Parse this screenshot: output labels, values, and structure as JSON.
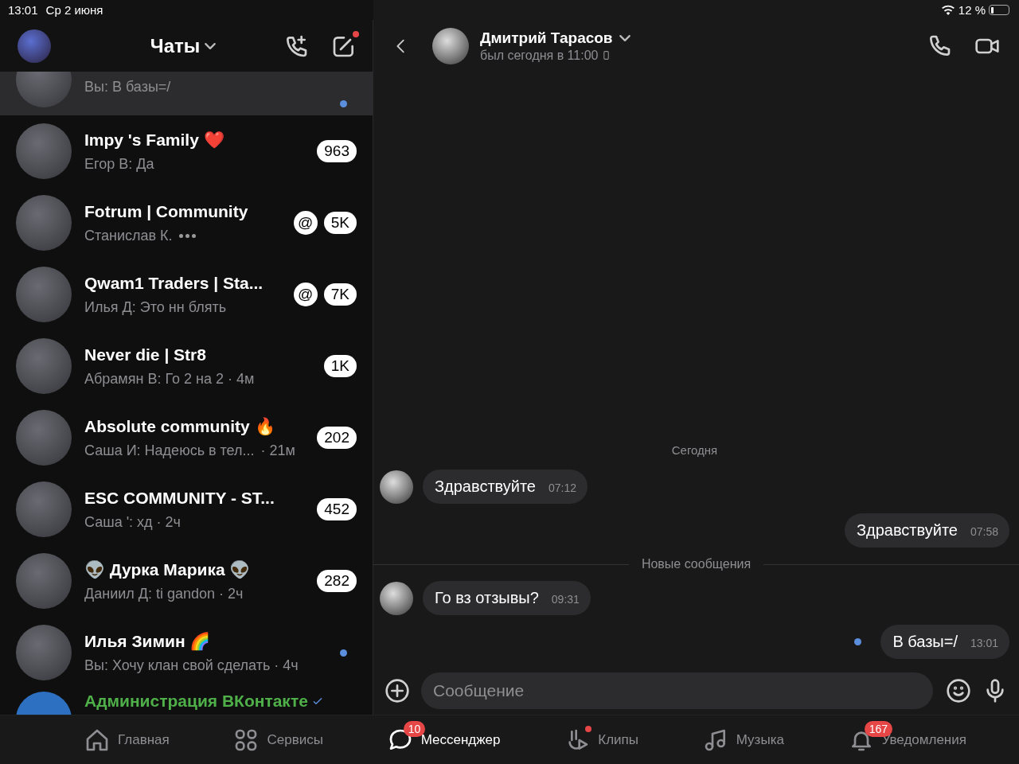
{
  "status_bar": {
    "time": "13:01",
    "date": "Ср 2 июня",
    "battery": "12 %"
  },
  "chats_header": {
    "title": "Чаты",
    "compose_dot": true
  },
  "chats": [
    {
      "preview": "Вы: В базы=/",
      "unread_dot": true,
      "selected": true
    },
    {
      "name": "Impy 's Family ❤️",
      "preview": "Егор В: Да",
      "count": "963",
      "unread_dot": false,
      "selected": false
    },
    {
      "name": "Fotrum | Community",
      "preview": "Станислав К.",
      "typing": true,
      "count": "5K",
      "mention": "@",
      "unread_dot": false,
      "selected": false
    },
    {
      "name": "Qwam1 Traders | Sta...",
      "preview": "Илья Д: Это нн блять",
      "count": "7K",
      "mention": "@",
      "unread_dot": false,
      "selected": false
    },
    {
      "name": "Never die | Str8",
      "preview": "Абрамян В: Го 2 на 2 · 4м",
      "count": "1K",
      "unread_dot": false,
      "selected": false
    },
    {
      "name": "Absolute community 🔥",
      "preview": "Саша И: Надеюсь в тел...",
      "time": "· 21м",
      "count": "202",
      "unread_dot": false,
      "selected": false
    },
    {
      "name": "ESC COMMUNITY - ST...",
      "preview": "Саша ': хд · 2ч",
      "count": "452",
      "unread_dot": false,
      "selected": false
    },
    {
      "name": "👽 Дурка Марика 👽",
      "preview": "Даниил Д: ti gandon · 2ч",
      "count": "282",
      "unread_dot": false,
      "selected": false
    },
    {
      "name": "Илья Зимин 🌈",
      "preview": "Вы: Хочу клан свой сделать · 4ч",
      "unread_dot": true,
      "selected": false
    },
    {
      "name": "Администрация ВКонтакте",
      "verified": true,
      "selected": false
    }
  ],
  "conversation": {
    "name": "Дмитрий Тарасов",
    "last_seen": "был сегодня в 11:00",
    "messages": [
      {
        "kind": "date",
        "text": "Сегодня"
      },
      {
        "kind": "incoming",
        "text": "Здравствуйте",
        "time": "07:12"
      },
      {
        "kind": "outgoing",
        "text": "Здравствуйте",
        "time": "07:58",
        "unread": false
      },
      {
        "kind": "divider",
        "text": "Новые сообщения"
      },
      {
        "kind": "incoming",
        "text": "Го вз отзывы?",
        "time": "09:31"
      },
      {
        "kind": "outgoing",
        "text": "В базы=/",
        "time": "13:01",
        "unread": true
      }
    ],
    "input": {
      "placeholder": "Сообщение"
    }
  },
  "tab_bar": [
    {
      "label": "Главная",
      "kind": "home",
      "selected": false
    },
    {
      "label": "Сервисы",
      "kind": "grid",
      "selected": false
    },
    {
      "label": "Мессенджер",
      "kind": "chat",
      "selected": true,
      "badge": "10"
    },
    {
      "label": "Клипы",
      "kind": "clips",
      "selected": false,
      "dot": true
    },
    {
      "label": "Музыка",
      "kind": "music",
      "selected": false
    },
    {
      "label": "Уведомления",
      "kind": "bell",
      "selected": false,
      "badge": "167"
    }
  ]
}
